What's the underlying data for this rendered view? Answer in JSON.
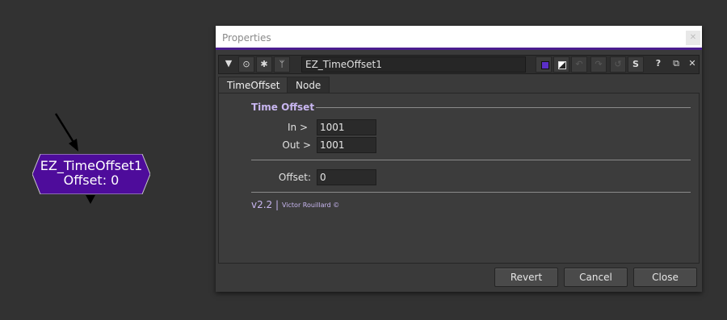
{
  "node_graph": {
    "node": {
      "name": "EZ_TimeOffset1",
      "offset_label": "Offset: 0",
      "color": "#4e0c9b"
    }
  },
  "properties": {
    "window_title": "Properties",
    "toolbar": {
      "node_name": "EZ_TimeOffset1",
      "help_label": "?",
      "s_label": "S",
      "node_color": "#5b2fc7"
    },
    "tabs": [
      {
        "label": "TimeOffset",
        "active": true
      },
      {
        "label": "Node",
        "active": false
      }
    ],
    "section_title": "Time Offset",
    "fields": {
      "in": {
        "label": "In >",
        "value": "1001"
      },
      "out": {
        "label": "Out >",
        "value": "1001"
      },
      "offset": {
        "label": "Offset:",
        "value": "0"
      }
    },
    "version": "v2.2 |",
    "credit": "Victor Rouillard ©",
    "buttons": {
      "revert": "Revert",
      "cancel": "Cancel",
      "close": "Close"
    }
  }
}
